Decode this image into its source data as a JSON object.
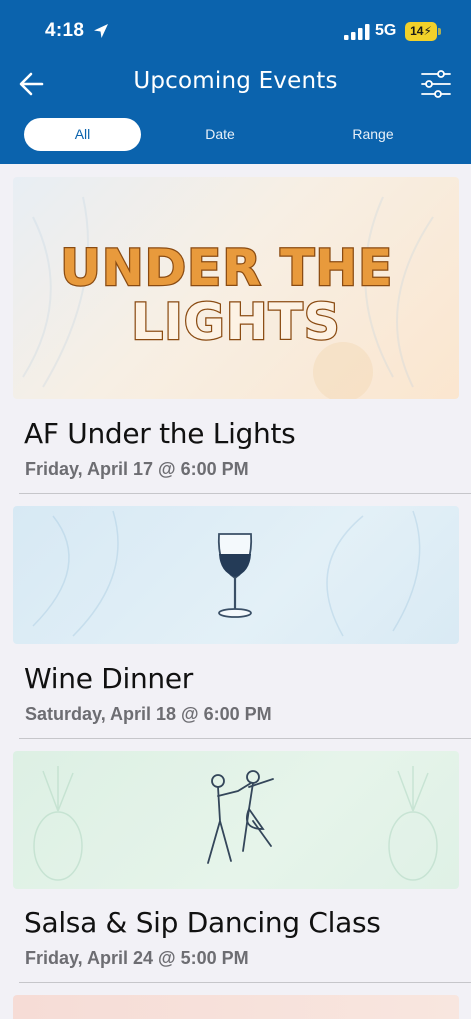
{
  "status_bar": {
    "time": "4:18",
    "network": "5G",
    "battery": "14",
    "icons": [
      "location-arrow-icon",
      "signal-bars-icon",
      "battery-charging-icon"
    ]
  },
  "header": {
    "title": "Upcoming Events",
    "back_icon": "arrow-left-icon",
    "filter_icon": "sliders-icon"
  },
  "tabs": [
    {
      "label": "All",
      "selected": true
    },
    {
      "label": "Date",
      "selected": false
    },
    {
      "label": "Range",
      "selected": false
    }
  ],
  "events": [
    {
      "banner_text": "UNDER THE LIGHTS",
      "title": "AF Under the Lights",
      "date": "Friday, April 17 @ 6:00 PM"
    },
    {
      "banner_icon": "wine-glass-icon",
      "title": "Wine Dinner",
      "date": "Saturday, April 18 @ 6:00 PM"
    },
    {
      "banner_icon": "dancing-couple-icon",
      "title": "Salsa & Sip Dancing Class",
      "date": "Friday, April 24 @ 5:00 PM"
    }
  ],
  "colors": {
    "header_bg": "#0b63ad",
    "page_bg": "#f2f1f6",
    "banner_orange": "#e89a3c",
    "battery_yellow": "#f2d12a"
  }
}
